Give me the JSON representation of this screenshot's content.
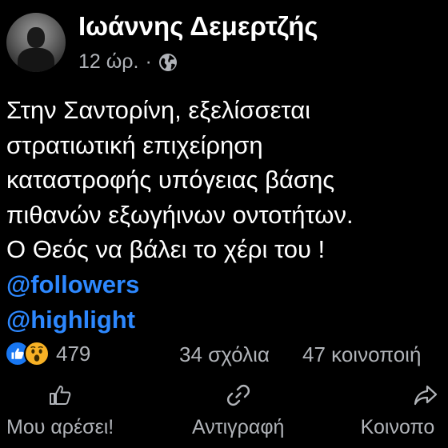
{
  "post": {
    "author": "Ιωάννης Δεμερτζής",
    "time": "12 ώρ.",
    "separator": "·",
    "privacy_icon": "globe-icon",
    "text_lines": [
      "Στην Σαντορίνη, εξελίσσεται",
      "στρατιωτική επιχείρηση",
      "καταστροφής υπόγειας βάσης",
      "πιθανών εξωγήινων οντοτήτων.",
      "Ο Θεός να βάλει το χέρι του !"
    ],
    "tags": [
      "@followers",
      "@highlight"
    ]
  },
  "stats": {
    "reaction_icons": [
      "like-icon",
      "wow-icon"
    ],
    "reactions_count": "479",
    "comments": "34 σχόλια",
    "shares": "47 κοινοποιή"
  },
  "actions": {
    "like_label": "Μου αρέσει!",
    "copy_label": "Αντιγραφή",
    "share_label": "Κοινοπο"
  },
  "colors": {
    "background": "#000000",
    "text": "#ffffff",
    "secondary": "#b0b3b8",
    "link": "#2d88ff",
    "like_blue": "#1877f2",
    "wow_yellow": "#f7b125"
  }
}
